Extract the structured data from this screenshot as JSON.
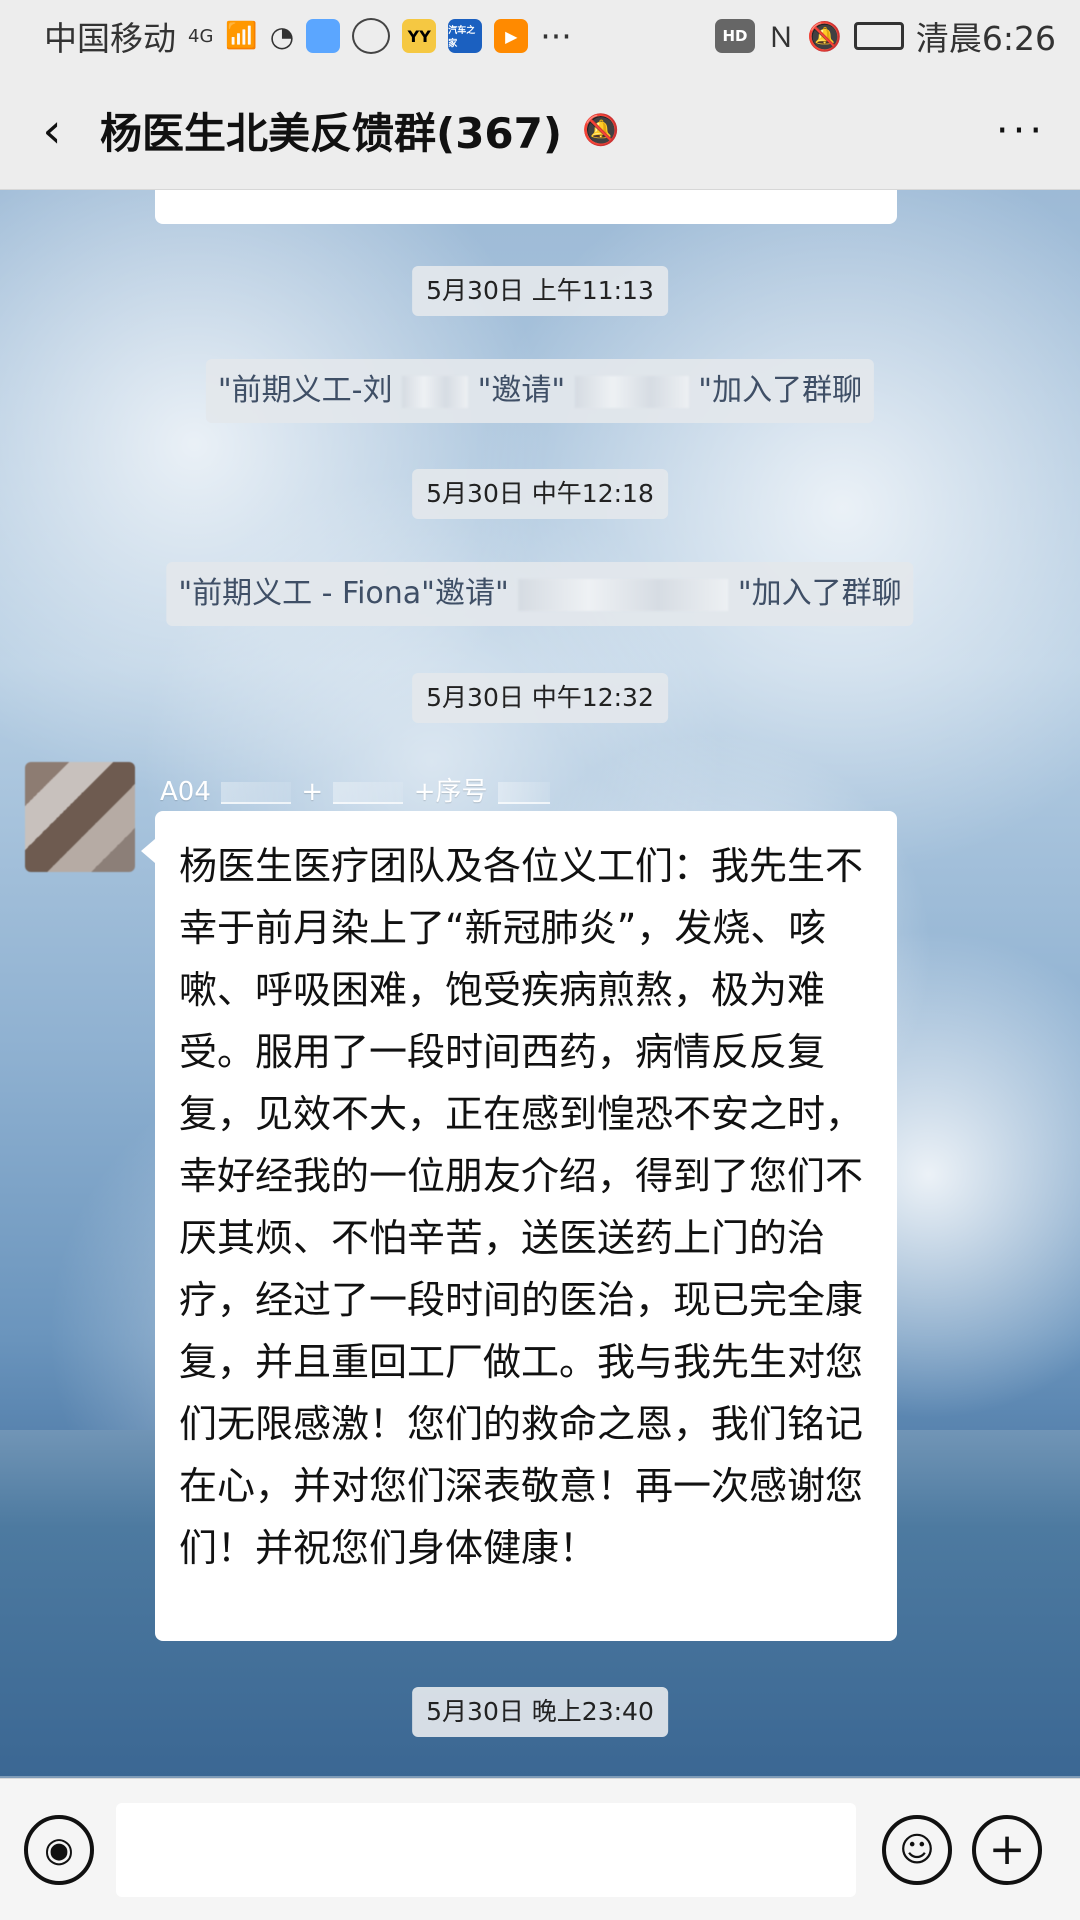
{
  "status_bar": {
    "carrier": "中国移动",
    "signal_label": "4G",
    "app_badges": [
      "",
      "",
      "YY",
      "汽车之家",
      ""
    ],
    "right_hd": "HD",
    "time": "清晨6:26"
  },
  "header": {
    "title": "杨医生北美反馈群(367)"
  },
  "messages": {
    "timestamp1": "5月30日 上午11:13",
    "system1_prefix": "\"前期义工-刘",
    "system1_middle": "\"邀请\"",
    "system1_suffix": "\"加入了群聊",
    "timestamp2": "5月30日 中午12:18",
    "system2_prefix": "\"前期义工 - Fiona\"邀请\"",
    "system2_suffix": "\"加入了群聊",
    "timestamp3": "5月30日 中午12:32",
    "sender_prefix": "A04",
    "sender_plus": "+",
    "sender_serial": "+序号",
    "bubble_text": "杨医生医疗团队及各位义工们：我先生不幸于前月染上了“新冠肺炎”，发烧、咳嗽、呼吸困难，饱受疾病煎熬，极为难受。服用了一段时间西药，病情反反复复，见效不大，正在感到惶恐不安之时，幸好经我的一位朋友介绍，得到了您们不厌其烦、不怕辛苦，送医送药上门的治疗，经过了一段时间的医治，现已完全康复，并且重回工厂做工。我与我先生对您们无限感激！您们的救命之恩，我们铭记在心，并对您们深表敬意！再一次感谢您们！并祝您们身体健康！",
    "timestamp4": "5月30日 晚上23:40"
  }
}
